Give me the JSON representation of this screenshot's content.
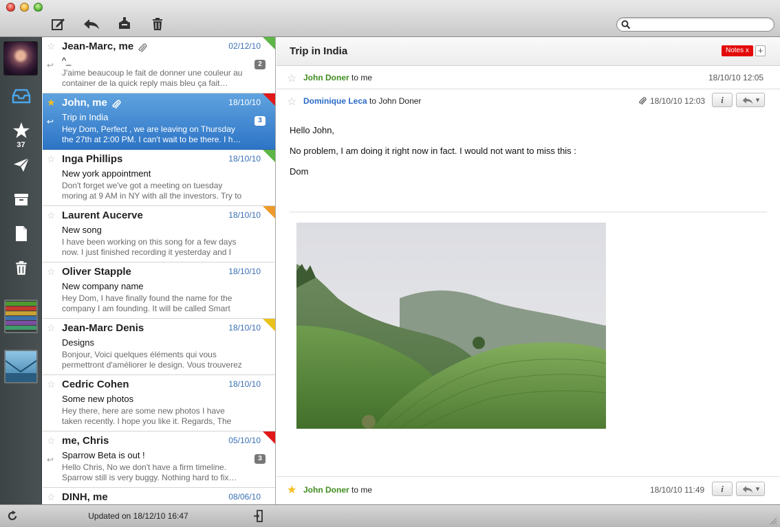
{
  "toolbar": {
    "compose_icon": "compose-icon",
    "reply_icon": "reply-icon",
    "archive_icon": "archive-icon",
    "trash_icon": "trash-icon",
    "search_placeholder": ""
  },
  "sidebar": {
    "starred_count": "37",
    "label_colors": [
      "#4e9a2f",
      "#c33b2f",
      "#c7a233",
      "#3f6fa8",
      "#7c4ea0",
      "#3f9a6a"
    ]
  },
  "messages": [
    {
      "from": "Jean-Marc, me",
      "date": "02/12/10",
      "subject": "^_",
      "preview": "J'aime beaucoup le fait de donner une couleur au container de la quick reply mais bleu ça fait…",
      "count": "2",
      "reply": true,
      "attachment": true,
      "starred": false,
      "selected": false,
      "tag_color": "green"
    },
    {
      "from": "John, me",
      "date": "18/10/10",
      "subject": "Trip in India",
      "preview": "Hey Dom, Perfect , we are leaving on Thursday the 27th at 2:00 PM. I can't wait to be there. I h…",
      "count": "3",
      "reply": true,
      "attachment": true,
      "starred": true,
      "selected": true,
      "tag_color": "red"
    },
    {
      "from": "Inga Phillips",
      "date": "18/10/10",
      "subject": "New york appointment",
      "preview": "Don't forget we've got a meeting on tuesday moring at 9 AM in NY with all the investors. Try to wear a s…",
      "count": "",
      "reply": false,
      "attachment": false,
      "starred": false,
      "selected": false,
      "tag_color": "green"
    },
    {
      "from": "Laurent Aucerve",
      "date": "18/10/10",
      "subject": "New song",
      "preview": "I have been working on this song for a few days now. I just finished recording it yesterday and I tho…",
      "count": "",
      "reply": false,
      "attachment": false,
      "starred": false,
      "selected": false,
      "tag_color": "orange"
    },
    {
      "from": "Oliver Stapple",
      "date": "18/10/10",
      "subject": "New company name",
      "preview": "Hey Dom, I have finally found the name for the company I am founding. It will be called Smart Gra…",
      "count": "",
      "reply": false,
      "attachment": false,
      "starred": false,
      "selected": false,
      "tag_color": ""
    },
    {
      "from": "Jean-Marc Denis",
      "date": "18/10/10",
      "subject": "Designs",
      "preview": "Bonjour, Voici quelques éléments qui vous permettront d'améliorer le design. Vous trouverez l…",
      "count": "",
      "reply": false,
      "attachment": false,
      "starred": false,
      "selected": false,
      "tag_color": "yellow"
    },
    {
      "from": "Cedric Cohen",
      "date": "18/10/10",
      "subject": "Some new photos",
      "preview": "Hey there, here are some new photos I have taken recently. I hope you like it. Regards, The Sparrow …",
      "count": "",
      "reply": false,
      "attachment": false,
      "starred": false,
      "selected": false,
      "tag_color": ""
    },
    {
      "from": "me, Chris",
      "date": "05/10/10",
      "subject": "Sparrow Beta is out !",
      "preview": "Hello Chris, No we don't have a firm timeline. Sparrow still is very buggy. Nothing hard to fix…",
      "count": "3",
      "reply": true,
      "attachment": false,
      "starred": false,
      "selected": false,
      "tag_color": "red"
    },
    {
      "from": "DINH, me",
      "date": "08/06/10",
      "subject": "",
      "preview": "",
      "count": "",
      "reply": false,
      "attachment": false,
      "starred": false,
      "selected": false,
      "tag_color": ""
    }
  ],
  "status": {
    "updated": "Updated on 18/12/10 16:47"
  },
  "pane": {
    "subject": "Trip in India",
    "tag": "Notes",
    "tag_remove": "x",
    "tag_add": "+",
    "first_sender": "John Doner",
    "first_to": "to me",
    "first_time": "18/10/10 12:05",
    "second_sender": "Dominique Leca",
    "second_to": "to John Doner",
    "second_time": "18/10/10 12:03",
    "body": [
      "Hello John,",
      "No problem, I am doing it right now in fact. I would not want to miss this :",
      "Dom"
    ],
    "last_sender": "John Doner",
    "last_to": "to me",
    "last_time": "18/10/10 11:49",
    "info_label": "i"
  }
}
